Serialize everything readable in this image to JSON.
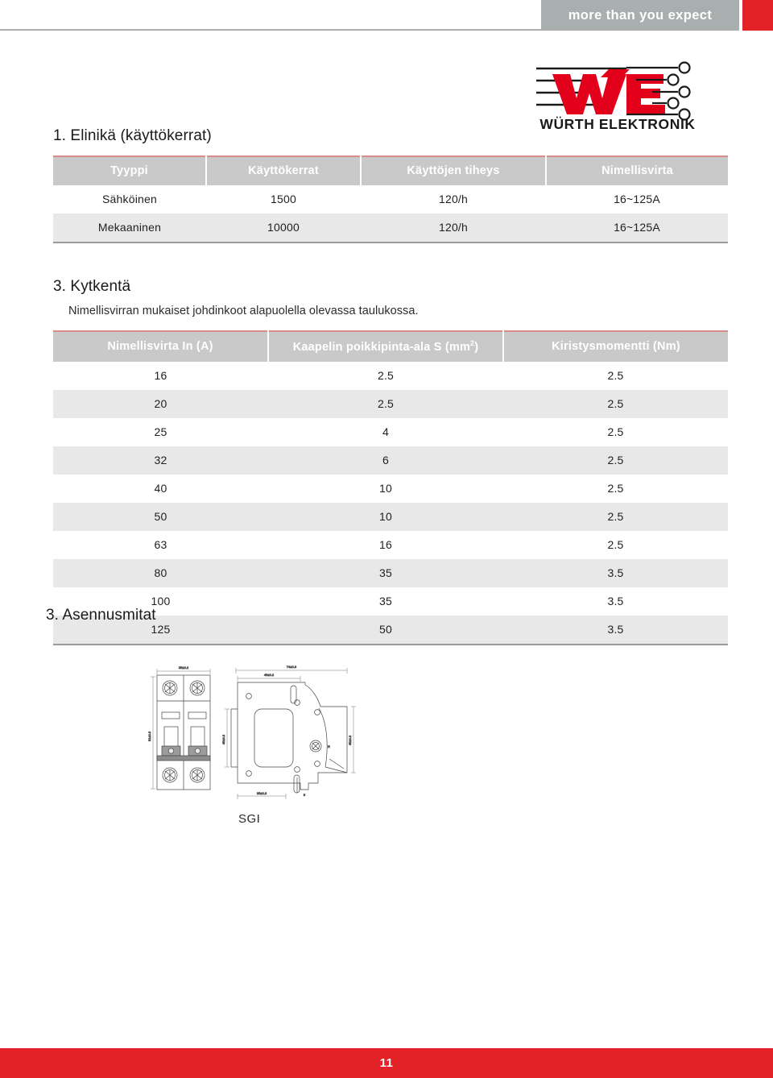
{
  "header": {
    "slogan": "more than you expect",
    "logo": {
      "mark_text": "WE",
      "wordmark": "WÜRTH ELEKTRONIK",
      "brand_red": "#e2001a",
      "brand_dark": "#1a1a1a"
    },
    "bar_gray": "#a9aeae",
    "bar_red": "#e32228"
  },
  "sections": {
    "elinika": {
      "heading": "1. Elinikä (käyttökerrat)"
    },
    "kytkenta": {
      "heading": "3. Kytkentä",
      "subtext": "Nimellisvirran mukaiset johdinkoot alapuolella olevassa taulukossa."
    },
    "asennusmitat": {
      "heading": "3. Asennusmitat",
      "drawing_caption": "SGI"
    }
  },
  "table_elinika": {
    "columns": [
      "Tyyppi",
      "Käyttökerrat",
      "Käyttöjen tiheys",
      "Nimellisvirta"
    ],
    "rows": [
      [
        "Sähköinen",
        "1500",
        "120/h",
        "16~125A"
      ],
      [
        "Mekaaninen",
        "10000",
        "120/h",
        "16~125A"
      ]
    ]
  },
  "table_kytkenta": {
    "columns": [
      "Nimellisvirta In (A)",
      "Kaapelin poikkipinta-ala S (mm²)",
      "Kiristysmomentti (Nm)"
    ],
    "column_parts": {
      "col2_base": "Kaapelin poikkipinta-ala S (mm",
      "col2_sup": "2",
      "col2_tail": ")"
    },
    "rows": [
      [
        "16",
        "2.5",
        "2.5"
      ],
      [
        "20",
        "2.5",
        "2.5"
      ],
      [
        "25",
        "4",
        "2.5"
      ],
      [
        "32",
        "6",
        "2.5"
      ],
      [
        "40",
        "10",
        "2.5"
      ],
      [
        "50",
        "10",
        "2.5"
      ],
      [
        "63",
        "16",
        "2.5"
      ],
      [
        "80",
        "35",
        "3.5"
      ],
      [
        "100",
        "35",
        "3.5"
      ],
      [
        "125",
        "50",
        "3.5"
      ]
    ]
  },
  "footer": {
    "page_number": "11",
    "background": "#e32228"
  },
  "colors": {
    "table_header_bg": "#c9c9c9",
    "row_alt_bg": "#e8e8e8",
    "table_top_rule": "#d98c8c",
    "table_bottom_rule": "#9a9a9a"
  }
}
